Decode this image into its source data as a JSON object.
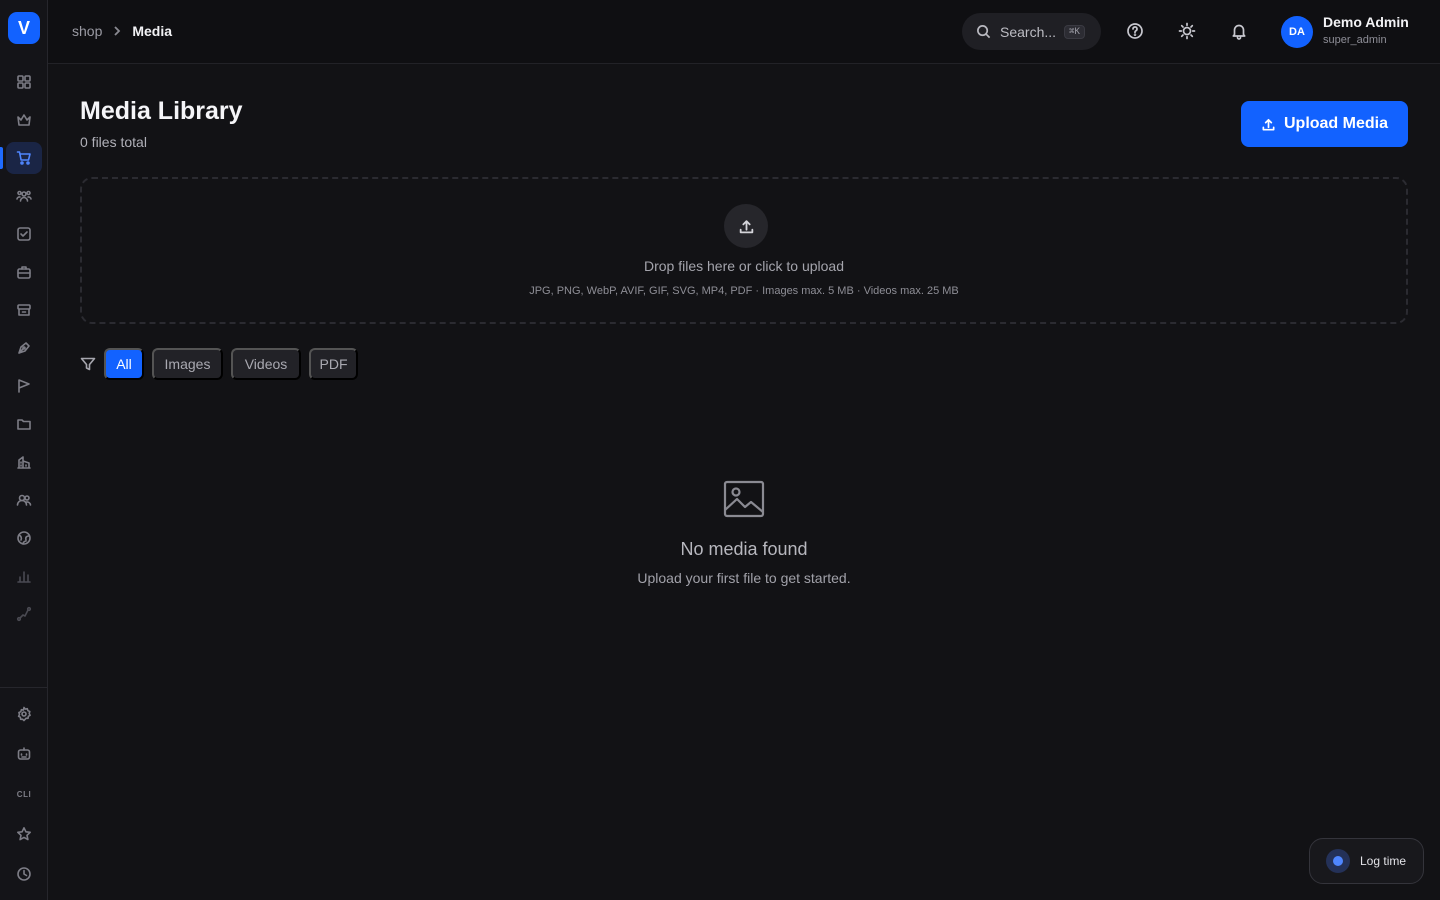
{
  "sidebar": {
    "logo": "V",
    "cli_label": "CLI",
    "items": [
      {
        "icon": "dashboard-grid-icon"
      },
      {
        "icon": "crown-icon"
      },
      {
        "icon": "shopping-cart-icon",
        "active": true
      },
      {
        "icon": "team-icon"
      },
      {
        "icon": "checkbox-icon"
      },
      {
        "icon": "briefcase-icon"
      },
      {
        "icon": "archive-box-icon"
      },
      {
        "icon": "pen-tool-icon"
      },
      {
        "icon": "flag-icon"
      },
      {
        "icon": "folder-icon"
      },
      {
        "icon": "buildings-icon"
      },
      {
        "icon": "users-icon"
      },
      {
        "icon": "globe-icon"
      },
      {
        "icon": "bar-chart-icon"
      },
      {
        "icon": "route-icon"
      }
    ],
    "bottom_items": [
      {
        "icon": "settings-gear-icon"
      },
      {
        "icon": "robot-icon"
      },
      {
        "icon": "cli-icon"
      },
      {
        "icon": "star-icon"
      },
      {
        "icon": "clock-icon"
      }
    ]
  },
  "header": {
    "breadcrumb": {
      "parent": "shop",
      "current": "Media"
    },
    "search": {
      "placeholder": "Search...",
      "shortcut": "⌘K"
    },
    "user": {
      "initials": "DA",
      "name": "Demo Admin",
      "role": "super_admin"
    }
  },
  "main": {
    "title": "Media Library",
    "subtitle": "0 files total",
    "upload_button": "Upload Media",
    "dropzone": {
      "title": "Drop files here or click to upload",
      "hint": "JPG, PNG, WebP, AVIF, GIF, SVG, MP4, PDF · Images max. 5 MB · Videos max. 25 MB"
    },
    "filters": [
      "All",
      "Images",
      "Videos",
      "PDF"
    ],
    "active_filter": "All",
    "empty": {
      "title": "No media found",
      "subtitle": "Upload your first file to get started."
    }
  },
  "log_time": {
    "label": "Log time"
  },
  "colors": {
    "accent": "#1262ff",
    "background": "#121215",
    "sidebar": "#141418"
  }
}
